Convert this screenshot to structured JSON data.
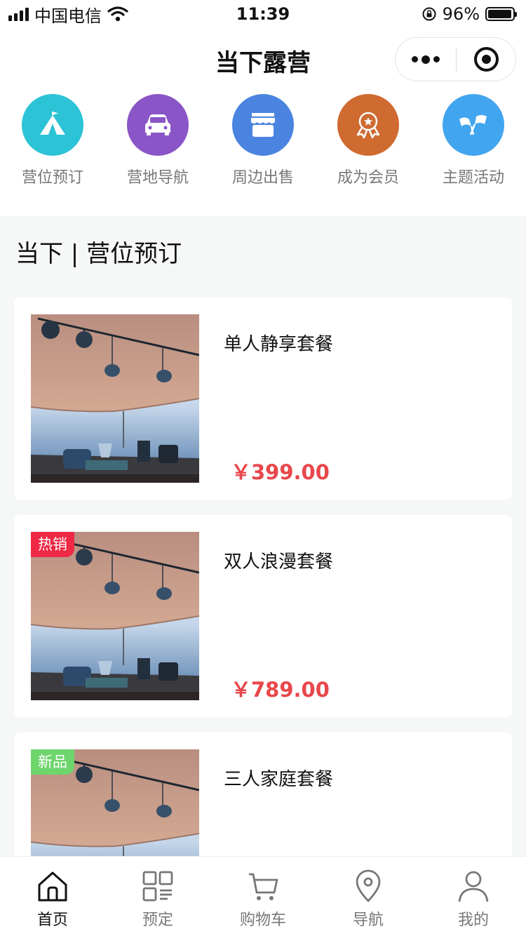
{
  "status_bar": {
    "carrier": "中国电信",
    "time": "11:39",
    "battery": "96%",
    "battery_level": 0.96
  },
  "nav": {
    "title": "当下露营"
  },
  "quick_menu": [
    {
      "label": "营位预订",
      "icon": "tent-icon",
      "color": "#2cc3d6"
    },
    {
      "label": "营地导航",
      "icon": "car-icon",
      "color": "#8a55c7"
    },
    {
      "label": "周边出售",
      "icon": "shop-icon",
      "color": "#4b84e0"
    },
    {
      "label": "成为会员",
      "icon": "medal-icon",
      "color": "#cf6a30"
    },
    {
      "label": "主题活动",
      "icon": "flags-icon",
      "color": "#42a5ef"
    }
  ],
  "section": {
    "title": "当下 | 营位预订"
  },
  "products": [
    {
      "name": "单人静享套餐",
      "price": "￥399.00",
      "badge": ""
    },
    {
      "name": "双人浪漫套餐",
      "price": "￥789.00",
      "badge": "热销",
      "badge_color": "#ef2845"
    },
    {
      "name": "三人家庭套餐",
      "price": "",
      "badge": "新品",
      "badge_color": "#6ed56d"
    }
  ],
  "tab_bar": [
    {
      "label": "首页",
      "icon": "home-icon",
      "active": true
    },
    {
      "label": "预定",
      "icon": "grid-list-icon",
      "active": false
    },
    {
      "label": "购物车",
      "icon": "cart-icon",
      "active": false
    },
    {
      "label": "导航",
      "icon": "location-pin-icon",
      "active": false
    },
    {
      "label": "我的",
      "icon": "user-icon",
      "active": false
    }
  ]
}
